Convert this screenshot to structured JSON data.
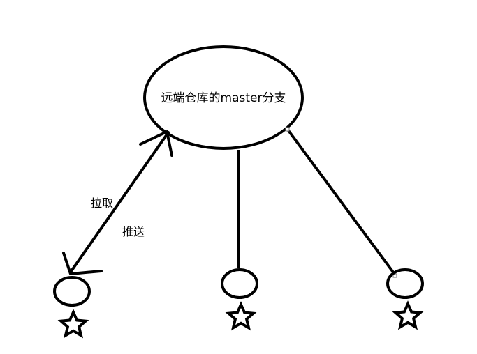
{
  "diagram": {
    "remote_label": "远端仓库的master分支",
    "pull_label": "拉取",
    "push_label": "推送"
  },
  "colors": {
    "stroke": "#000000",
    "background": "#ffffff"
  }
}
